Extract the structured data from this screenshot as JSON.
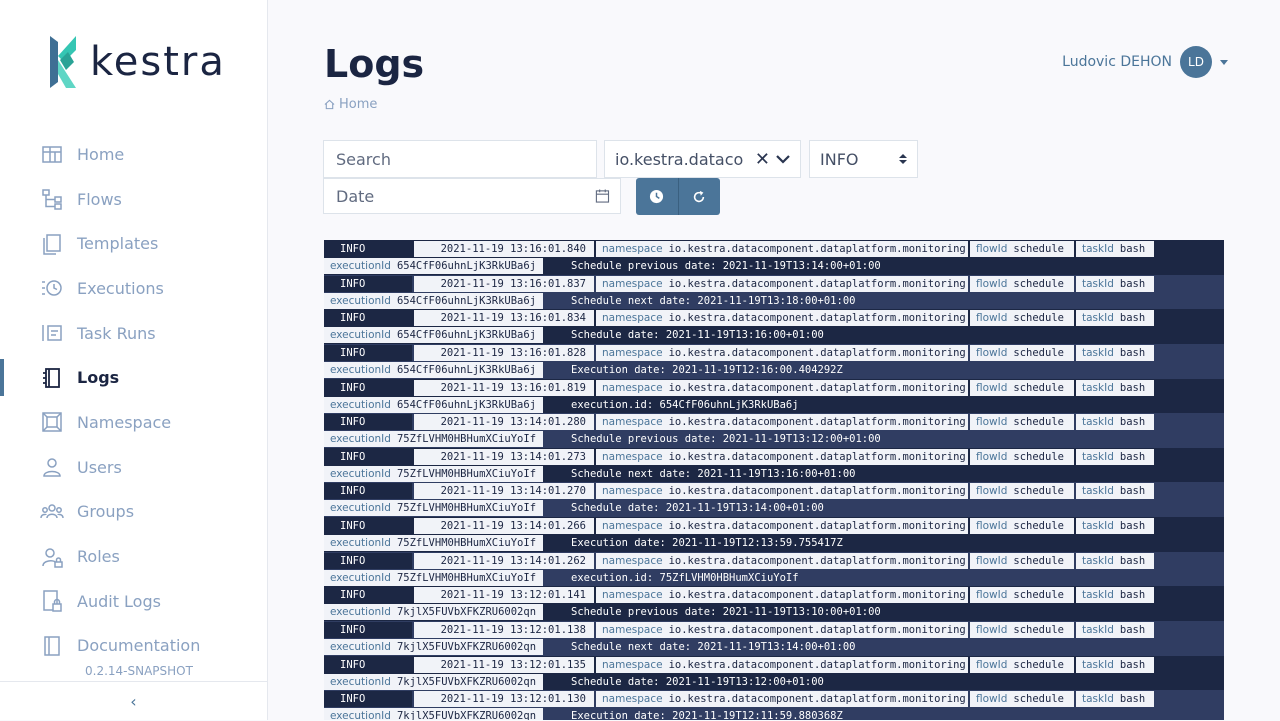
{
  "app": {
    "logo_text": "kestra",
    "version": "0.2.14-SNAPSHOT",
    "collapse_icon": "chevron-left-icon"
  },
  "sidebar": {
    "items": [
      {
        "label": "Home",
        "icon": "home-icon",
        "active": false
      },
      {
        "label": "Flows",
        "icon": "flows-icon",
        "active": false
      },
      {
        "label": "Templates",
        "icon": "templates-icon",
        "active": false
      },
      {
        "label": "Executions",
        "icon": "executions-icon",
        "active": false
      },
      {
        "label": "Task Runs",
        "icon": "task-runs-icon",
        "active": false
      },
      {
        "label": "Logs",
        "icon": "logs-icon",
        "active": true
      },
      {
        "label": "Namespace",
        "icon": "namespace-icon",
        "active": false
      },
      {
        "label": "Users",
        "icon": "users-icon",
        "active": false
      },
      {
        "label": "Groups",
        "icon": "groups-icon",
        "active": false
      },
      {
        "label": "Roles",
        "icon": "roles-icon",
        "active": false
      },
      {
        "label": "Audit Logs",
        "icon": "audit-logs-icon",
        "active": false
      },
      {
        "label": "Documentation",
        "icon": "documentation-icon",
        "active": false
      }
    ]
  },
  "header": {
    "title": "Logs",
    "breadcrumb": "Home",
    "user_name": "Ludovic DEHON",
    "user_initials": "LD"
  },
  "filters": {
    "search_placeholder": "Search",
    "namespace_value": "io.kestra.dataco",
    "level_value": "INFO",
    "date_placeholder": "Date"
  },
  "log_keys": {
    "namespace": "namespace",
    "flowId": "flowId",
    "taskId": "taskId",
    "executionId": "executionId"
  },
  "logs": [
    {
      "level": "INFO",
      "date": "2021-11-19 13:16:01.840",
      "namespace": "io.kestra.datacomponent.dataplatform.monitoring",
      "flowId": "schedule",
      "taskId": "bash",
      "executionId": "654CfF06uhnLjK3RkUBa6j",
      "message": "Schedule previous date: 2021-11-19T13:14:00+01:00"
    },
    {
      "level": "INFO",
      "date": "2021-11-19 13:16:01.837",
      "namespace": "io.kestra.datacomponent.dataplatform.monitoring",
      "flowId": "schedule",
      "taskId": "bash",
      "executionId": "654CfF06uhnLjK3RkUBa6j",
      "message": "Schedule next date: 2021-11-19T13:18:00+01:00"
    },
    {
      "level": "INFO",
      "date": "2021-11-19 13:16:01.834",
      "namespace": "io.kestra.datacomponent.dataplatform.monitoring",
      "flowId": "schedule",
      "taskId": "bash",
      "executionId": "654CfF06uhnLjK3RkUBa6j",
      "message": "Schedule date: 2021-11-19T13:16:00+01:00"
    },
    {
      "level": "INFO",
      "date": "2021-11-19 13:16:01.828",
      "namespace": "io.kestra.datacomponent.dataplatform.monitoring",
      "flowId": "schedule",
      "taskId": "bash",
      "executionId": "654CfF06uhnLjK3RkUBa6j",
      "message": "Execution date: 2021-11-19T12:16:00.404292Z"
    },
    {
      "level": "INFO",
      "date": "2021-11-19 13:16:01.819",
      "namespace": "io.kestra.datacomponent.dataplatform.monitoring",
      "flowId": "schedule",
      "taskId": "bash",
      "executionId": "654CfF06uhnLjK3RkUBa6j",
      "message": "execution.id: 654CfF06uhnLjK3RkUBa6j"
    },
    {
      "level": "INFO",
      "date": "2021-11-19 13:14:01.280",
      "namespace": "io.kestra.datacomponent.dataplatform.monitoring",
      "flowId": "schedule",
      "taskId": "bash",
      "executionId": "75ZfLVHM0HBHumXCiuYoIf",
      "message": "Schedule previous date: 2021-11-19T13:12:00+01:00"
    },
    {
      "level": "INFO",
      "date": "2021-11-19 13:14:01.273",
      "namespace": "io.kestra.datacomponent.dataplatform.monitoring",
      "flowId": "schedule",
      "taskId": "bash",
      "executionId": "75ZfLVHM0HBHumXCiuYoIf",
      "message": "Schedule next date: 2021-11-19T13:16:00+01:00"
    },
    {
      "level": "INFO",
      "date": "2021-11-19 13:14:01.270",
      "namespace": "io.kestra.datacomponent.dataplatform.monitoring",
      "flowId": "schedule",
      "taskId": "bash",
      "executionId": "75ZfLVHM0HBHumXCiuYoIf",
      "message": "Schedule date: 2021-11-19T13:14:00+01:00"
    },
    {
      "level": "INFO",
      "date": "2021-11-19 13:14:01.266",
      "namespace": "io.kestra.datacomponent.dataplatform.monitoring",
      "flowId": "schedule",
      "taskId": "bash",
      "executionId": "75ZfLVHM0HBHumXCiuYoIf",
      "message": "Execution date: 2021-11-19T12:13:59.755417Z"
    },
    {
      "level": "INFO",
      "date": "2021-11-19 13:14:01.262",
      "namespace": "io.kestra.datacomponent.dataplatform.monitoring",
      "flowId": "schedule",
      "taskId": "bash",
      "executionId": "75ZfLVHM0HBHumXCiuYoIf",
      "message": "execution.id: 75ZfLVHM0HBHumXCiuYoIf"
    },
    {
      "level": "INFO",
      "date": "2021-11-19 13:12:01.141",
      "namespace": "io.kestra.datacomponent.dataplatform.monitoring",
      "flowId": "schedule",
      "taskId": "bash",
      "executionId": "7kjlX5FUVbXFKZRU6002qn",
      "message": "Schedule previous date: 2021-11-19T13:10:00+01:00"
    },
    {
      "level": "INFO",
      "date": "2021-11-19 13:12:01.138",
      "namespace": "io.kestra.datacomponent.dataplatform.monitoring",
      "flowId": "schedule",
      "taskId": "bash",
      "executionId": "7kjlX5FUVbXFKZRU6002qn",
      "message": "Schedule next date: 2021-11-19T13:14:00+01:00"
    },
    {
      "level": "INFO",
      "date": "2021-11-19 13:12:01.135",
      "namespace": "io.kestra.datacomponent.dataplatform.monitoring",
      "flowId": "schedule",
      "taskId": "bash",
      "executionId": "7kjlX5FUVbXFKZRU6002qn",
      "message": "Schedule date: 2021-11-19T13:12:00+01:00"
    },
    {
      "level": "INFO",
      "date": "2021-11-19 13:12:01.130",
      "namespace": "io.kestra.datacomponent.dataplatform.monitoring",
      "flowId": "schedule",
      "taskId": "bash",
      "executionId": "7kjlX5FUVbXFKZRU6002qn",
      "message": "Execution date: 2021-11-19T12:11:59.880368Z"
    }
  ],
  "colors": {
    "accent": "#4b7599",
    "dark": "#1b2542",
    "muted": "#8aa1c1",
    "log_row_dark": "#1c2744",
    "log_row_light": "#303d62"
  }
}
